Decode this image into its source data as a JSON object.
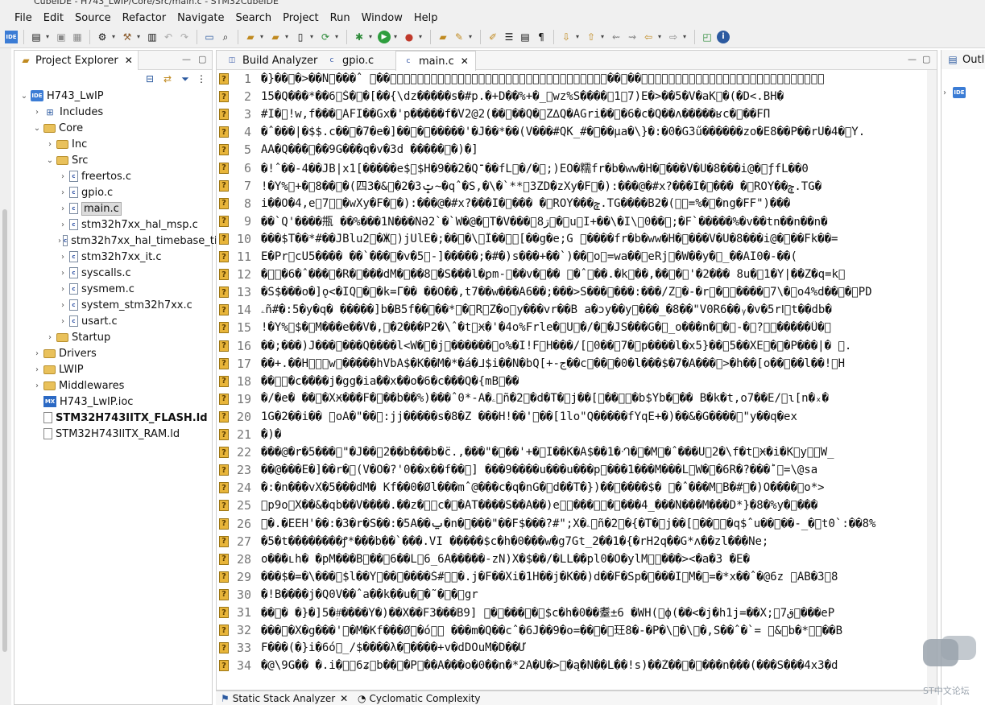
{
  "window": {
    "title": "CubeIDE - H743_LwIP/Core/Src/main.c - STM32CubeIDE"
  },
  "menu": [
    "File",
    "Edit",
    "Source",
    "Refactor",
    "Navigate",
    "Search",
    "Project",
    "Run",
    "Window",
    "Help"
  ],
  "explorer": {
    "tab_label": "Project Explorer",
    "tree": [
      {
        "label": "H743_LwIP",
        "depth": 0,
        "arrow": "v",
        "icon": "ide-project-icon"
      },
      {
        "label": "Includes",
        "depth": 1,
        "arrow": ">",
        "icon": "includes-icon"
      },
      {
        "label": "Core",
        "depth": 1,
        "arrow": "v",
        "icon": "folder-icon"
      },
      {
        "label": "Inc",
        "depth": 2,
        "arrow": ">",
        "icon": "folder-icon"
      },
      {
        "label": "Src",
        "depth": 2,
        "arrow": "v",
        "icon": "folder-icon"
      },
      {
        "label": "freertos.c",
        "depth": 3,
        "arrow": ">",
        "icon": "c-file-icon"
      },
      {
        "label": "gpio.c",
        "depth": 3,
        "arrow": ">",
        "icon": "c-file-icon"
      },
      {
        "label": "main.c",
        "depth": 3,
        "arrow": ">",
        "icon": "c-file-icon",
        "selected": true
      },
      {
        "label": "stm32h7xx_hal_msp.c",
        "depth": 3,
        "arrow": ">",
        "icon": "c-file-icon"
      },
      {
        "label": "stm32h7xx_hal_timebase_tim.c",
        "depth": 3,
        "arrow": ">",
        "icon": "c-file-icon"
      },
      {
        "label": "stm32h7xx_it.c",
        "depth": 3,
        "arrow": ">",
        "icon": "c-file-icon"
      },
      {
        "label": "syscalls.c",
        "depth": 3,
        "arrow": ">",
        "icon": "c-file-icon"
      },
      {
        "label": "sysmem.c",
        "depth": 3,
        "arrow": ">",
        "icon": "c-file-icon"
      },
      {
        "label": "system_stm32h7xx.c",
        "depth": 3,
        "arrow": ">",
        "icon": "c-file-icon"
      },
      {
        "label": "usart.c",
        "depth": 3,
        "arrow": ">",
        "icon": "c-file-icon"
      },
      {
        "label": "Startup",
        "depth": 2,
        "arrow": ">",
        "icon": "folder-icon"
      },
      {
        "label": "Drivers",
        "depth": 1,
        "arrow": ">",
        "icon": "folder-icon"
      },
      {
        "label": "LWIP",
        "depth": 1,
        "arrow": ">",
        "icon": "folder-icon"
      },
      {
        "label": "Middlewares",
        "depth": 1,
        "arrow": ">",
        "icon": "folder-icon"
      },
      {
        "label": "H743_LwIP.ioc",
        "depth": 1,
        "arrow": "",
        "icon": "mx-ioc-icon"
      },
      {
        "label": "STM32H743IITX_FLASH.ld",
        "depth": 1,
        "arrow": "",
        "icon": "ld-file-icon",
        "bold": true
      },
      {
        "label": "STM32H743IITX_RAM.ld",
        "depth": 1,
        "arrow": "",
        "icon": "ld-file-icon"
      }
    ]
  },
  "editor": {
    "tabs": [
      {
        "label": "Build Analyzer",
        "active": false,
        "closable": false
      },
      {
        "label": "gpio.c",
        "active": false,
        "closable": false
      },
      {
        "label": "main.c",
        "active": true,
        "closable": true
      }
    ],
    "lines": [
      {
        "n": "1",
        "text": "�}��\u0000�>��N\u0000���ˆ \u0000��\u0000\u0000\u0000\u0000\u0000\u0000\u0000\u0000\u0000\u0000\u0000\u0000\u0000\u0000\u0000\u0000\u0000\u0000\u0000\u0000\u0000\u0000\u0000\u0000\u0000\u0000\u0000\u0000\u0000\u0000\u0000\u0000��\u0000��\u0000\u0000\u0000\u0000\u0000\u0000\u0000\u0000\u0000\u0000\u0000\u0000\u0000\u0000\u0000\u0000\u0000\u0000\u0000\u0000\u0000\u0000\u0000\u0000\u0000\u0000\u0000"
      },
      {
        "n": "2",
        "text": "15�Q���*��6\u0000Š�\u0000�[��{\\dz�����s�#p.�+D��%+�_\u0000wz%S����\u00001\u00007)E�>��5�V�aK\u0000�(�D<.BH�"
      },
      {
        "n": "3",
        "text": "#I�\u0000!w,f���\u0000AFI��Gx�'p�����f�V2@2(��\u0000��Q�\u0000Z∆Q�AGri��\u0000�6�c�Q��ʌ�����ʁc�\u0000��FΠ"
      },
      {
        "n": "4",
        "text": "�ˆ���|�$$.c��\u0000�7�e�]��\u0000�\u0000�����'�J��*��(V���#QK_#�\u0000��μa�\\}�:�0�G3ű������zo�E8��P��rU�4�\u0000Y."
      },
      {
        "n": "5",
        "text": "AA�Q���\u0000��9G���q�v�3d �����\u0000�)�]"
      },
      {
        "n": "6",
        "text": "�!ˆ��-4��JB|x1[�����e$\u0000$H�9��2�Q־��fL\u0000�/�\u0000;)EO�糯fr�b�ww�H�\u0000���V�U�8���i@�\u0000ƒfL��0"
      },
      {
        "n": "7",
        "text": "!�Y%\u0000+�\u00008��\u0000�(四3�&\u0000�2�3ݓ~�qˆ�S,�\\�`**\u00003ZD�zXy�F\u0000�):���@�#x?���I�\u0000���  �\u0000ROY��ݯ.TG�"
      },
      {
        "n": "8",
        "text": "i��O�4,e\u00007\u0000\u0000�wXy�F�\u0000�):���@�#x?���I�\u0000��� �\u0000ROY���ݯ.TG����B2�(\u0000\u0000=%�\u0000�ng�FF\")���"
      },
      {
        "n": "9",
        "text": "��`Q'����甁 ��%���1N���NӘ2`�`W�@�\u0000T�V���ڗ\u00008\u0000�\u0000u\u0000I+��\\�I\\\u00000��\u0000;�F`�����%�v��tn��n��n�"
      },
      {
        "n": "10",
        "text": "���$T��*#��JBlu2\u0000�Ӂ\u0000)jUlE�;��\u0000�\\\u0000Ȉ��\u0000\u0000[��g�e;G  \u0000����fr�b�ww�H�\u0000���V�U�8���i@�\u0000��Fk��="
      },
      {
        "n": "11",
        "text": "E�Pr\u0000cU5���� ��`���\u0000�v�5\u0000-]�����;�#�)s���+��`)��\u0000o\u0000=wa��\u0000eRj\u0000�W��y�\u0000_��AI0�-��("
      },
      {
        "n": "12",
        "text": "�\u0000\u0000�6�ˆ���\u0000�R�\u0000���dM�\u0000��8\u0000�S���l�ꝑm-\u0000��v�\u0000�� \u0000�ˆ\u0000��.�k\u0000��,��\u0000�\u0000'�2��� 8u�\u00001�Y|��Z�q=k\u0000"
      },
      {
        "n": "13",
        "text": "�S$���o�]ǫ<�IQ\u0000�\u0000�k=Γ�� ��O��,t7��w���A6��;���>S���\u0000���:���/Z\u0000�-�r\u0000�\u0000\u0000����\u00007\\�\u0000o4%d��\u0000�\u0000PD"
      },
      {
        "n": "14",
        "text": "ۦñ#�:5�y�q� �����]b�B5f��\u0000��*\u0000�\u0000R\u0000Z�o\u0000y���vr��B a�ɔy��y\u0000���_�8��\"V0R6��ᵧ�v�5rߊ\u0000t��db�"
      },
      {
        "n": "15",
        "text": "!�Y%\u0000$�\u0000M���e��V�,\u0000�2���P2�\\ˆ�t\u0000Ӿ�'�4o%Frle�\u0000U\u0000�/�\u0000�JS���G�\u0000_o���n�\u0000�\u0000-�\u0000?\u0000\u0000�����Û�\u0000"
      },
      {
        "n": "16",
        "text": "��;���)J���\u0000���Q����l<W�\u0000�j\u0000������\u0000o%�I!F\u0000H���/[\u00000��\u00007�\u0000p����l�x5}��\u00005��XE\u0000�\u0000�P���|�  \u0000."
      },
      {
        "n": "17",
        "text": "��+.��H\u0000\u0000\u0000w\u0000�����hVbA$�K��M�*�á�ᒧ$i��N�bQ[+-ج��c\u0000��\u0000�0�l���$�7�A���\u0000>�h��[o��\u0000��l��!\u0000H"
      },
      {
        "n": "18",
        "text": "��\u0000\u0000�c����j�gg�ia��x��o�6�c���Q�{mB\u0000��"
      },
      {
        "n": "19",
        "text": "�/�e�   ��\u0000�XӾ���F�\u0000��b��%)���ˆ0*-A�\u0000ۦñ�2\u0000�d�T�\u0000j��[\u0000��\u0000\u0000�b$Yb�\u0000�� B�k�t,o7��E/\u0000ɩ[n�ₓ�"
      },
      {
        "n": "20",
        "text": "1G�2��i�� \u0000oA�\"��\u0000:jj�����s�8�Z ���H!��'\u0000��[1lo\"Q�����fYqE+�)��&�G����\u0000\"y��q�ex"
      },
      {
        "n": "21",
        "text": "�)�"
      },
      {
        "n": "22",
        "text": "���@�r�5���\u0000\"�J��\u00002��b���b�c̈.,���\"�\u0000��'+�\u0000I��K�A$��1�ᒒ�\u0000�M\u0000�ˆ���U\u00002�\\f�t\u0000Ӿ�i�K\u0000y\u0000\u0000W_"
      },
      {
        "n": "23",
        "text": "��@���E�]��r�\u0000(V�O�?'0��x��f��\u0000]  ���9����u���u���p\u0000���1���M���L\u0000W�\u0000�6R�?���ؕ\u0000=\\@sa"
      },
      {
        "n": "24",
        "text": "�:�n���vX�5���dM� Kf��0�Øl���mˆ@���c�q�nG�\u0000d��T�})��\u0000����$� \u0000�ˆ���M\u0000B�#\u0000�)O����\u0000o*>"
      },
      {
        "n": "25",
        "text": "\u0000p9o\u0000X��&�qb��V����.��z�\u0000\u0000c�\u0000�AT����S��A��)e\u0000\u0000���\u0000\u0000�\u0000���4_���N���M���D*}�8�%y�\u0000���"
      },
      {
        "n": "26",
        "text": "\u0000�.�EEH'��:�3�r�S��:�5A��ݐ�n�\u0000���\"��F$���?#\";X�\u0000ۦñ�2\u0000�{�T�\u0000j��[\u0000��\u0000\u0000�q$ˆu��\u0000��-_�\u0000t0`:��8%"
      },
      {
        "n": "27",
        "text": "�5�t�\u0000��\u0000\u0000�\u0000����ꝭ*�\u0000��b��`���.VI \u0000�\u0000���\u0000�\u0000$c�h�0��\u0000�w\u0000�g7Gt\u0000_2��\u00001�{�rH2q��G*ʌ�\u0000�zl���Ne;"
      },
      {
        "n": "28",
        "text": "o���ւh�    �pM���B\u0000��\u00006��L\u00006_6A�����-zN)X�$��/�LL��pl0�O�ylM\u0000\u0000���><�a�3 �E�"
      },
      {
        "n": "29",
        "text": "���$�=�\\���\u0000$l��Y\u0000��\u0000����Ś#\u0000\u0000�.j�F��Xi�1H��j�K��)d��F�Sp�\u0000���I\u0000M�\u0000=�*x��ˆ�@6z  \u0000AB�3\u00008"
      },
      {
        "n": "30",
        "text": "�!B����j�Q0V��ˆa��k��u�\u0000�˜�\u0000�\u0000gr"
      },
      {
        "n": "31",
        "text": "��\u0000� �}�]5�#ؚ����Y�)��X��F3���B9] \u0000�\u0000���\u0000�\u0000$c�h�0��耋±6 �WH(\u0000ф(��<�j�h1j=��X;\u0000ق\u00007���eP"
      },
      {
        "n": "32",
        "text": "���\u0000�X�g���'\u0000�M�Kf���Ø\u0000�ó\u0000\u0000  ���m�Q��cˆ�6J��9�o=��\u0000�\u0000玨8�-�P�\\\u0000�\\\u0000�,S��ˆ�`= \u0000&\u0000b�*\u0000\u0000��B"
      },
      {
        "n": "33",
        "text": "F���(�}i�6ó\u0000_/$����λ�\u0000����+v�dDOuM�D��Ư"
      },
      {
        "n": "34",
        "text": "�@\\9G��  �.i�\u0000\u00006ʑ\u0000b��\u0000�P\u0000��A���o�0��n�*2A�U�>\u0000�ą�N��L��!s)��Ż��\u0000�\u0000���n���(���S���4x3�d"
      }
    ]
  },
  "outline": {
    "tab_label": "Outline"
  },
  "bottom": {
    "tabs": [
      "Static Stack Analyzer",
      "Cyclomatic Complexity"
    ]
  },
  "watermark": {
    "text": "ST中文论坛"
  }
}
